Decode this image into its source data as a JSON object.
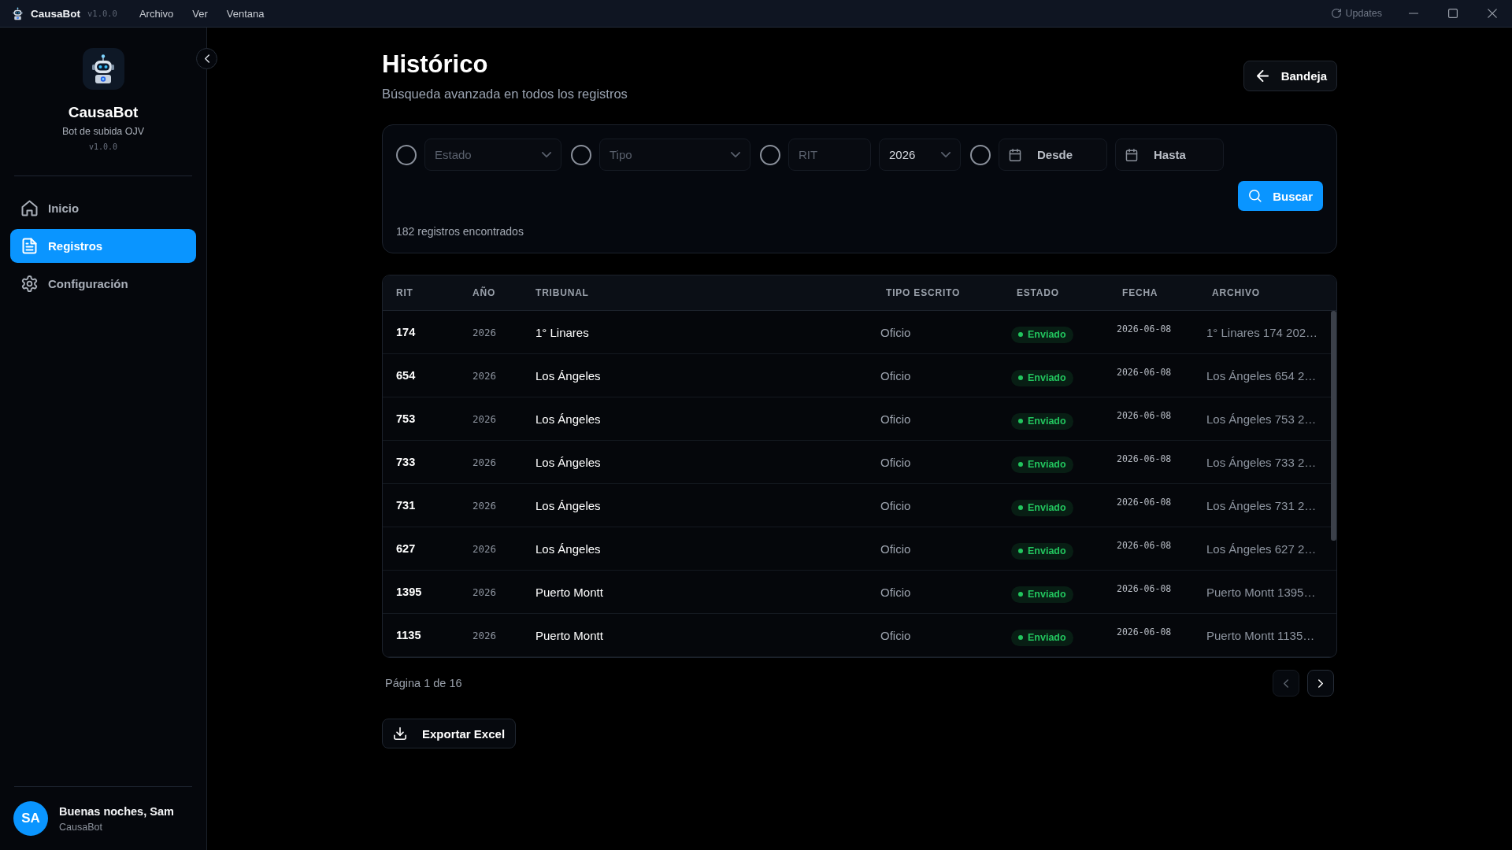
{
  "title_bar": {
    "app_name": "CausaBot",
    "version": "v1.0.0",
    "menus": [
      "Archivo",
      "Ver",
      "Ventana"
    ],
    "updates_label": "Updates"
  },
  "sidebar": {
    "app_name": "CausaBot",
    "subtitle": "Bot de subida OJV",
    "version": "v1.0.0",
    "nav_items": [
      {
        "label": "Inicio",
        "selected": false
      },
      {
        "label": "Registros",
        "selected": true
      },
      {
        "label": "Configuración",
        "selected": false
      }
    ],
    "user": {
      "initials": "SA",
      "greeting": "Buenas noches, Sam",
      "subtitle": "CausaBot"
    }
  },
  "header": {
    "title": "Histórico",
    "subtitle": "Búsqueda avanzada en todos los registros",
    "back_button": "Bandeja"
  },
  "filters": {
    "groups": [
      {
        "checked": false,
        "fields": [
          {
            "kind": "select",
            "placeholder": "Estado"
          }
        ]
      },
      {
        "checked": false,
        "fields": [
          {
            "kind": "select",
            "placeholder": "Tipo"
          }
        ]
      },
      {
        "checked": false,
        "fields": [
          {
            "kind": "input",
            "placeholder": "RIT"
          },
          {
            "kind": "select",
            "value": "2026"
          }
        ]
      },
      {
        "checked": false,
        "fields": [
          {
            "kind": "date",
            "label": "Desde"
          },
          {
            "kind": "date",
            "label": "Hasta"
          }
        ]
      }
    ],
    "search_button": "Buscar",
    "result_count": "182 registros encontrados"
  },
  "table": {
    "columns": [
      "RIT",
      "AÑO",
      "TRIBUNAL",
      "TIPO ESCRITO",
      "ESTADO",
      "FECHA",
      "ARCHIVO"
    ],
    "rows": [
      {
        "rit": "174",
        "year": "2026",
        "tribunal": "1° Linares",
        "tipo": "Oficio",
        "estado": {
          "label": "Enviado",
          "color": "#22c55e"
        },
        "fecha": "2026-06-08",
        "archivo": "1° Linares 174 202…"
      },
      {
        "rit": "654",
        "year": "2026",
        "tribunal": "Los Ángeles",
        "tipo": "Oficio",
        "estado": {
          "label": "Enviado",
          "color": "#22c55e"
        },
        "fecha": "2026-06-08",
        "archivo": "Los Ángeles 654 2…"
      },
      {
        "rit": "753",
        "year": "2026",
        "tribunal": "Los Ángeles",
        "tipo": "Oficio",
        "estado": {
          "label": "Enviado",
          "color": "#22c55e"
        },
        "fecha": "2026-06-08",
        "archivo": "Los Ángeles 753 2…"
      },
      {
        "rit": "733",
        "year": "2026",
        "tribunal": "Los Ángeles",
        "tipo": "Oficio",
        "estado": {
          "label": "Enviado",
          "color": "#22c55e"
        },
        "fecha": "2026-06-08",
        "archivo": "Los Ángeles 733 2…"
      },
      {
        "rit": "731",
        "year": "2026",
        "tribunal": "Los Ángeles",
        "tipo": "Oficio",
        "estado": {
          "label": "Enviado",
          "color": "#22c55e"
        },
        "fecha": "2026-06-08",
        "archivo": "Los Ángeles 731 2…"
      },
      {
        "rit": "627",
        "year": "2026",
        "tribunal": "Los Ángeles",
        "tipo": "Oficio",
        "estado": {
          "label": "Enviado",
          "color": "#22c55e"
        },
        "fecha": "2026-06-08",
        "archivo": "Los Ángeles 627 2…"
      },
      {
        "rit": "1395",
        "year": "2026",
        "tribunal": "Puerto Montt",
        "tipo": "Oficio",
        "estado": {
          "label": "Enviado",
          "color": "#22c55e"
        },
        "fecha": "2026-06-08",
        "archivo": "Puerto Montt 1395…"
      },
      {
        "rit": "1135",
        "year": "2026",
        "tribunal": "Puerto Montt",
        "tipo": "Oficio",
        "estado": {
          "label": "Enviado",
          "color": "#22c55e"
        },
        "fecha": "2026-06-08",
        "archivo": "Puerto Montt 1135…"
      }
    ]
  },
  "pagination": {
    "label": "Página 1 de 16",
    "buttons": [
      {
        "kind": "prev",
        "disabled": true
      },
      {
        "kind": "next",
        "disabled": false
      }
    ]
  },
  "export_button": "Exportar Excel"
}
